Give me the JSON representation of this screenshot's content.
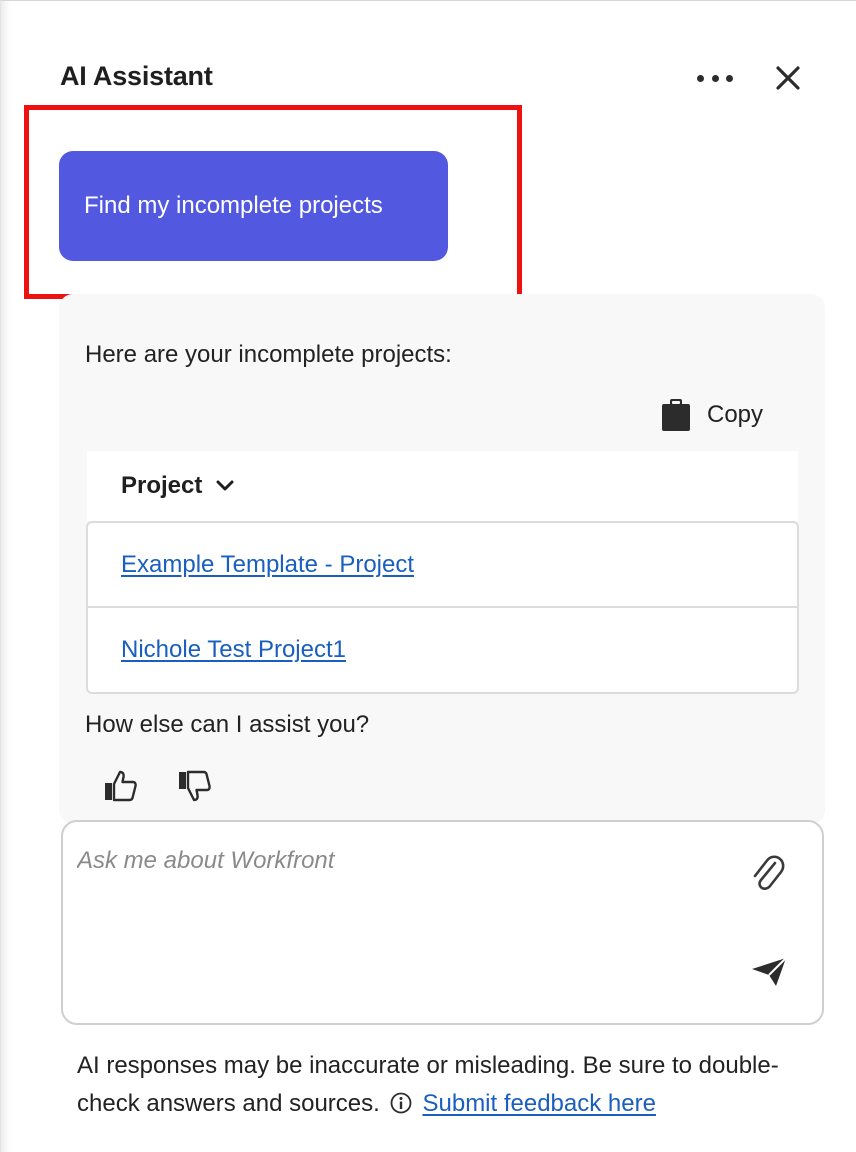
{
  "header": {
    "title": "AI Assistant",
    "more_icon": "more-horizontal-icon",
    "close_icon": "close-icon"
  },
  "prompt": {
    "label": "Find my incomplete projects"
  },
  "response": {
    "intro": "Here are your incomplete projects:",
    "copy_label": "Copy",
    "copy_icon": "clipboard-icon",
    "table": {
      "column_header": "Project",
      "sort_icon": "chevron-down-icon",
      "rows": [
        {
          "project": "Example Template - Project"
        },
        {
          "project": "Nichole Test Project1"
        }
      ]
    },
    "followup": "How else can I assist you?",
    "feedback_icons": [
      "thumbs-up-icon",
      "thumbs-down-icon"
    ]
  },
  "composer": {
    "placeholder": "Ask me about Workfront",
    "attach_icon": "paperclip-icon",
    "send_icon": "send-icon"
  },
  "disclaimer": {
    "text": "AI responses may be inaccurate or misleading. Be sure to double-check answers and sources.",
    "info_icon": "info-icon",
    "link_label": "Submit feedback here"
  },
  "colors": {
    "accent_button": "#5258e0",
    "highlight_border": "#ee1111",
    "link": "#1a5fbf",
    "card_background": "#f8f8f8"
  }
}
